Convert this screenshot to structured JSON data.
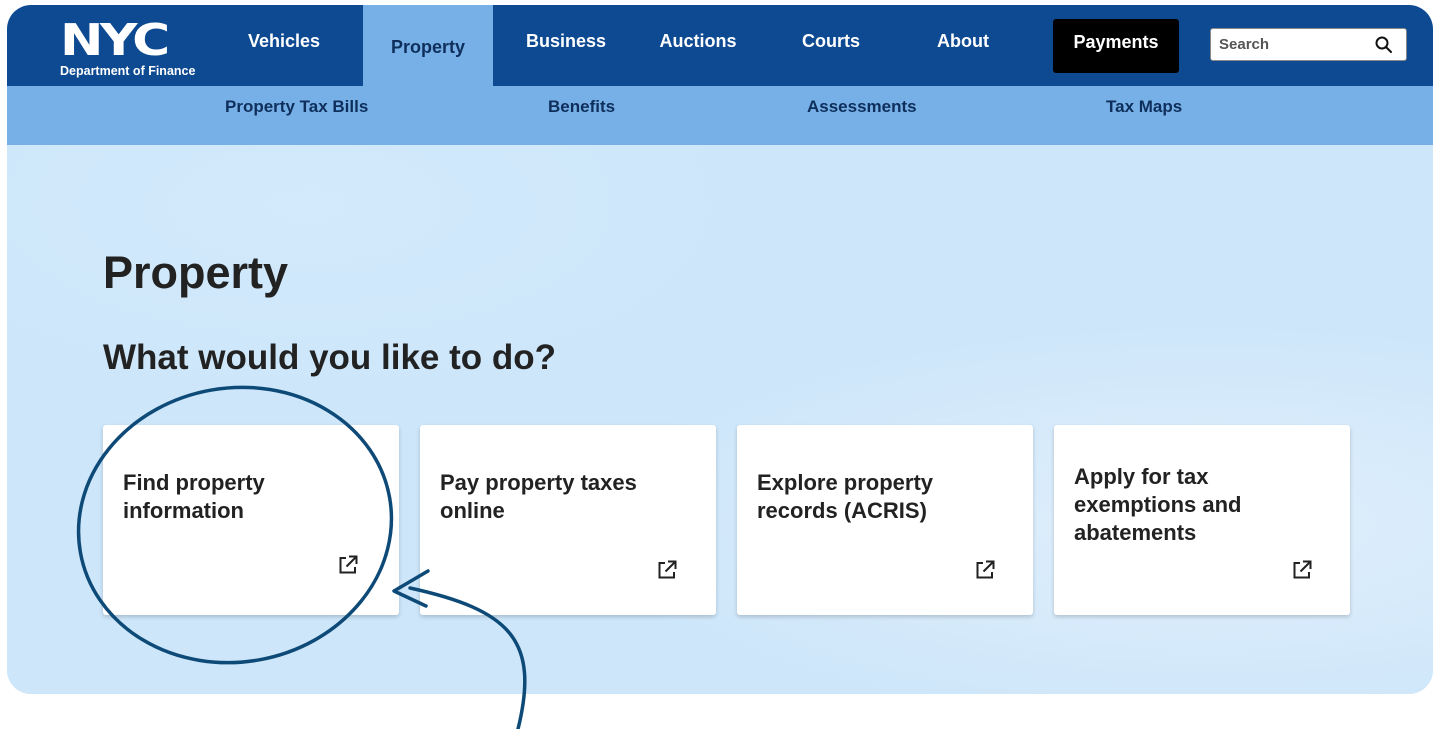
{
  "logo": {
    "word": "NYC",
    "subtitle": "Department of Finance"
  },
  "topnav": {
    "items": [
      {
        "label": "Vehicles"
      },
      {
        "label": "Property"
      },
      {
        "label": "Business"
      },
      {
        "label": "Auctions"
      },
      {
        "label": "Courts"
      },
      {
        "label": "About"
      }
    ],
    "active": "Property",
    "payments_label": "Payments",
    "search_placeholder": "Search"
  },
  "subnav": {
    "items": [
      {
        "label": "Property Tax Bills"
      },
      {
        "label": "Benefits"
      },
      {
        "label": "Assessments"
      },
      {
        "label": "Tax Maps"
      }
    ]
  },
  "main": {
    "title": "Property",
    "section_title": "What would you like to do?",
    "cards": [
      {
        "title": "Find property information"
      },
      {
        "title": "Pay property taxes online"
      },
      {
        "title": "Explore property records (ACRIS)"
      },
      {
        "title": "Apply for tax exemptions and abatements"
      }
    ]
  },
  "icons": {
    "external_link": "external-link-icon",
    "search": "search-icon"
  },
  "colors": {
    "nav_bg": "#0e4a92",
    "subnav_bg": "#77b0e6",
    "page_bg": "#cde6fa",
    "annotation": "#0e4a77"
  }
}
